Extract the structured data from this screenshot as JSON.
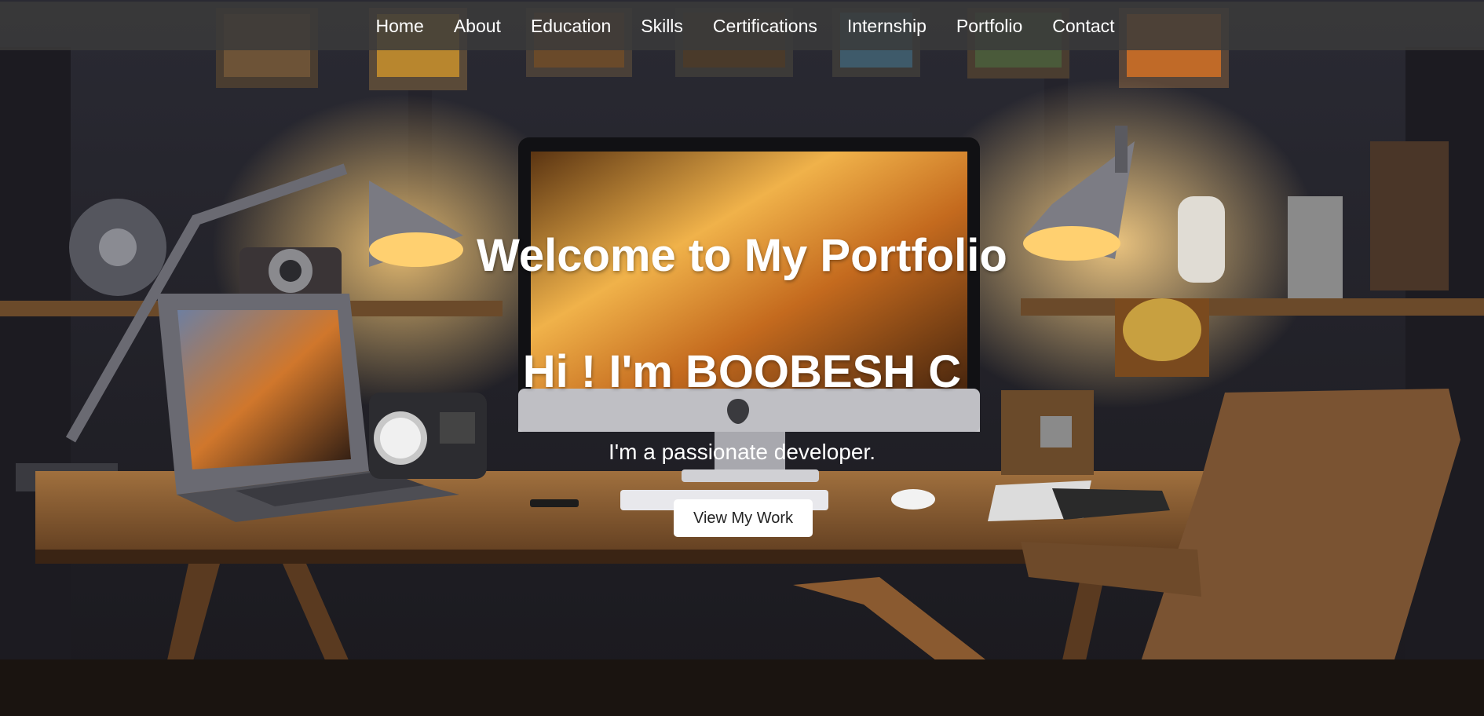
{
  "nav": {
    "items": [
      {
        "label": "Home"
      },
      {
        "label": "About"
      },
      {
        "label": "Education"
      },
      {
        "label": "Skills"
      },
      {
        "label": "Certifications"
      },
      {
        "label": "Internship"
      },
      {
        "label": "Portfolio"
      },
      {
        "label": "Contact"
      }
    ]
  },
  "hero": {
    "title": "Welcome to My Portfolio",
    "name": "Hi ! I'm BOOBESH C",
    "tagline": "I'm a passionate developer.",
    "cta_label": "View My Work"
  },
  "colors": {
    "navbar_bg": "#3a3a3a",
    "text": "#ffffff",
    "button_bg": "#ffffff",
    "button_text": "#222222"
  }
}
